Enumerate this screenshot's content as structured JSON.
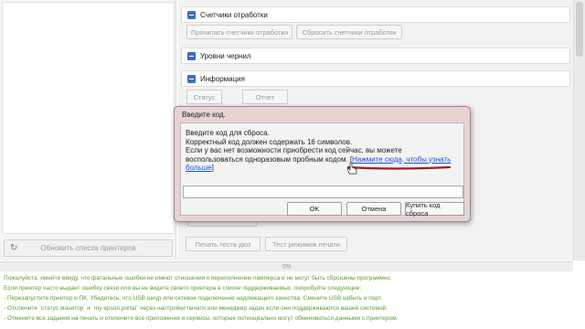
{
  "left_panel": {
    "refresh_button": "Обновить список принтеров"
  },
  "sections": {
    "counters": {
      "title": "Счетчики отработки",
      "read_button": "Прочитать счетчики отработки",
      "reset_button": "Сбросить счетчики отработки"
    },
    "ink_levels": {
      "title": "Уровни чернил"
    },
    "info": {
      "title": "Информация",
      "status_button": "Статус",
      "report_button": "Отчет"
    }
  },
  "bottom_buttons": {
    "nozzle_test": "Печать теста дюз",
    "mode_test": "Тест режимов печати"
  },
  "progress_text": "0%",
  "dialog": {
    "title": "Введите код.",
    "message_lines": [
      "Введите код для сброса.",
      "Корректный код должен содержать 16 символов.",
      "Если у вас нет возможности приобрести код сейчас, вы можете",
      "воспользоваться одноразовым пробным кодом. ["
    ],
    "link_text_1": "Нажмите сюда, чтобы узнать",
    "link_text_2": "больше",
    "link_close": "]",
    "code_value": "",
    "ok_button": "OK",
    "cancel_button": "Отмена",
    "buy_button": "Купить код сброса"
  },
  "log_lines": [
    "Пожалуйста, имейте ввиду, что фатальные ошибки не имеют отношения к переполнению памперса и не могут быть сброшены программно.",
    "Если принтер часто выдает ошибку связи или вы не видите своего принтера в списке поддерживаемых, попробуйте следующее:",
    "- Перезапустите принтер и ПК. Убедитесь, что USB шнур или сетевое подключение надлежащего качества. Смените USB кабель и порт.",
    "- Отключите `статус монитор` и `my epson portal` через настройки печати или менеджер задач если они поддерживаются вашей системой.",
    "- Отмените все задания на печать и отключите все приложения и сервисы, которые потенциально могут обмениваться данными с принтером."
  ],
  "colors": {
    "log_text": "#5a9e2a",
    "link": "#1a4fd6",
    "scribble": "#9e1a2a",
    "toggle": "#3a6fc4"
  }
}
